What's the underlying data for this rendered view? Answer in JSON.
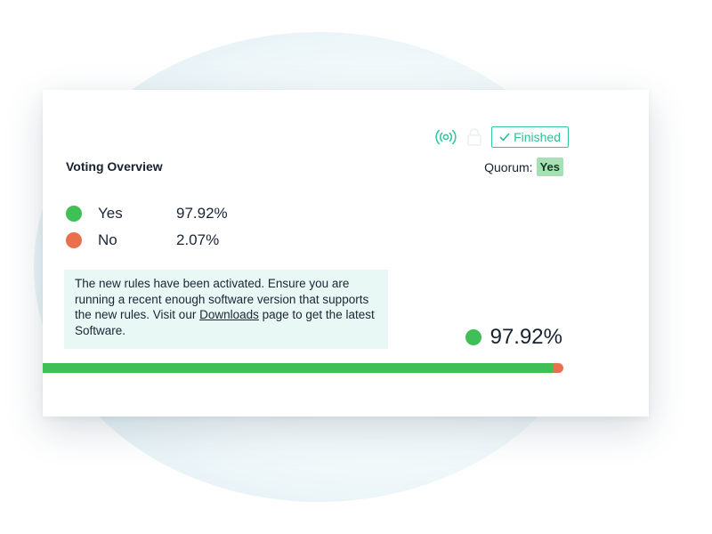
{
  "status": {
    "finished_label": "Finished",
    "icons": [
      "broadcast-icon",
      "lock-icon",
      "check-icon"
    ],
    "accent_color": "#2fbf98"
  },
  "overview": {
    "title": "Voting Overview",
    "quorum_label": "Quorum:",
    "quorum_value": "Yes"
  },
  "results": {
    "yes_label": "Yes",
    "yes_value": "97.92%",
    "no_label": "No",
    "no_value": "2.07%",
    "yes_fraction": 0.9792,
    "yes_color": "#3fbf56",
    "no_color": "#e8704d"
  },
  "notice": {
    "text_before": "The new rules have been activated. Ensure you are running a recent enough software version that supports the new rules. Visit our ",
    "link_text": "Downloads",
    "text_after": " page to get the latest Software."
  },
  "summary": {
    "leading_value": "97.92%"
  }
}
